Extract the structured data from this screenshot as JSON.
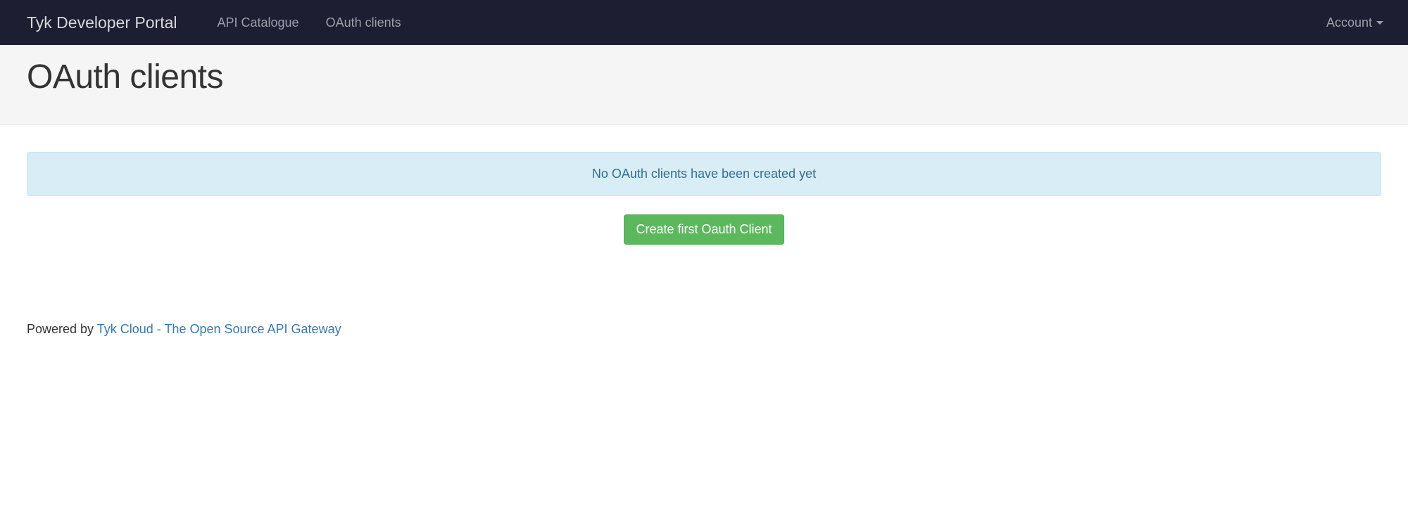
{
  "navbar": {
    "brand": "Tyk Developer Portal",
    "nav": {
      "api_catalogue": "API Catalogue",
      "oauth_clients": "OAuth clients"
    },
    "account": "Account"
  },
  "page": {
    "title": "OAuth clients"
  },
  "alert": {
    "no_clients": "No OAuth clients have been created yet"
  },
  "buttons": {
    "create_first": "Create first Oauth Client"
  },
  "footer": {
    "powered_by": "Powered by ",
    "link_text": "Tyk Cloud - The Open Source API Gateway"
  }
}
